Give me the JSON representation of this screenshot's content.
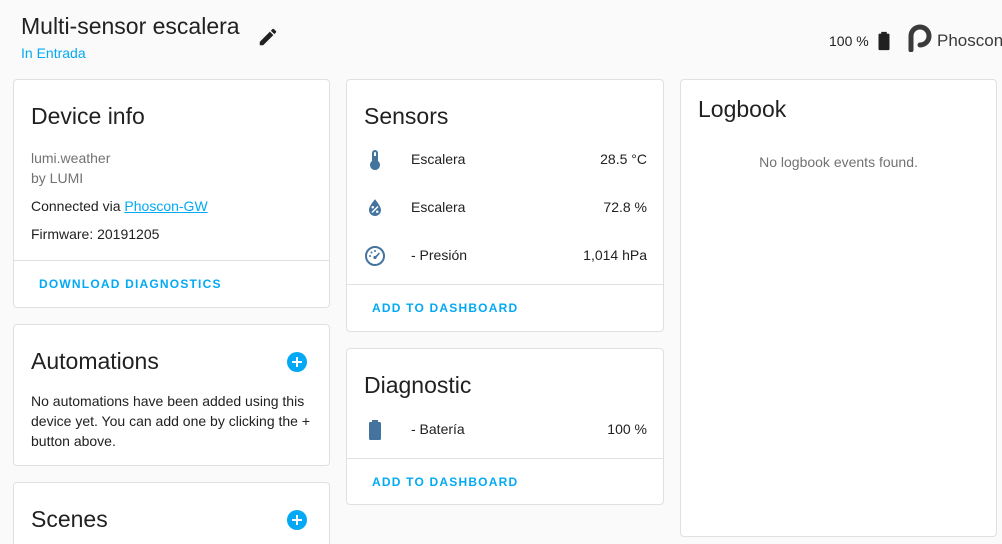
{
  "header": {
    "title": "Multi-sensor escalera",
    "area": "In Entrada",
    "battery": "100 %",
    "brand": "Phoscon"
  },
  "device_info": {
    "title": "Device info",
    "model": "lumi.weather",
    "manufacturer": "by LUMI",
    "connected_prefix": "Connected via ",
    "connected_link": "Phoscon-GW",
    "firmware": "Firmware: 20191205",
    "action": "DOWNLOAD DIAGNOSTICS"
  },
  "automations": {
    "title": "Automations",
    "empty_text": "No automations have been added using this device yet. You can add one by clicking the + button above."
  },
  "scenes": {
    "title": "Scenes"
  },
  "sensors": {
    "title": "Sensors",
    "items": [
      {
        "icon": "thermometer-icon",
        "name": "Escalera",
        "value": "28.5 °C"
      },
      {
        "icon": "water-percent-icon",
        "name": "Escalera",
        "value": "72.8 %"
      },
      {
        "icon": "gauge-icon",
        "name": "- Presión",
        "value": "1,014 hPa"
      }
    ],
    "action": "ADD TO DASHBOARD"
  },
  "diagnostic": {
    "title": "Diagnostic",
    "items": [
      {
        "icon": "battery-icon",
        "name": "- Batería",
        "value": "100 %"
      }
    ],
    "action": "ADD TO DASHBOARD"
  },
  "logbook": {
    "title": "Logbook",
    "empty_text": "No logbook events found."
  },
  "colors": {
    "accent": "#03a9f4",
    "icon": "#44739e",
    "background": "#fafafa"
  }
}
